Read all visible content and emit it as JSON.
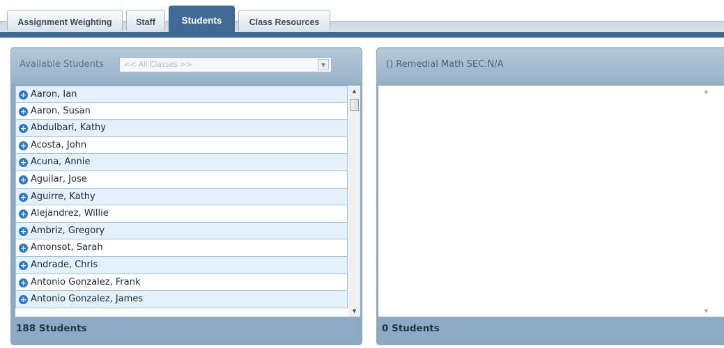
{
  "tabs": [
    {
      "label": "Assignment Weighting",
      "active": false
    },
    {
      "label": "Staff",
      "active": false
    },
    {
      "label": "Students",
      "active": true
    },
    {
      "label": "Class Resources",
      "active": false
    }
  ],
  "available_panel": {
    "label": "Available Students",
    "class_filter": {
      "selected": "<< All Classes >>"
    },
    "students": [
      "Aaron, Ian",
      "Aaron, Susan",
      "Abdulbari, Kathy",
      "Acosta, John",
      "Acuna, Annie",
      "Aguilar, Jose",
      "Aguirre, Kathy",
      "Alejandrez, Willie",
      "Ambriz, Gregory",
      "Amonsot, Sarah",
      "Andrade, Chris",
      "Antonio Gonzalez, Frank",
      "Antonio Gonzalez, James"
    ],
    "count": "188 Students",
    "add_icon": "plus-circle-icon"
  },
  "class_panel": {
    "title": "() Remedial Math SEC:N/A",
    "count": "0 Students"
  },
  "colors": {
    "accent": "#3f6a96",
    "panel": "#8ea9c3",
    "row_alt": "#e4f1fb",
    "row_border": "#9ec4e4",
    "add_icon": "#2d79c6"
  }
}
